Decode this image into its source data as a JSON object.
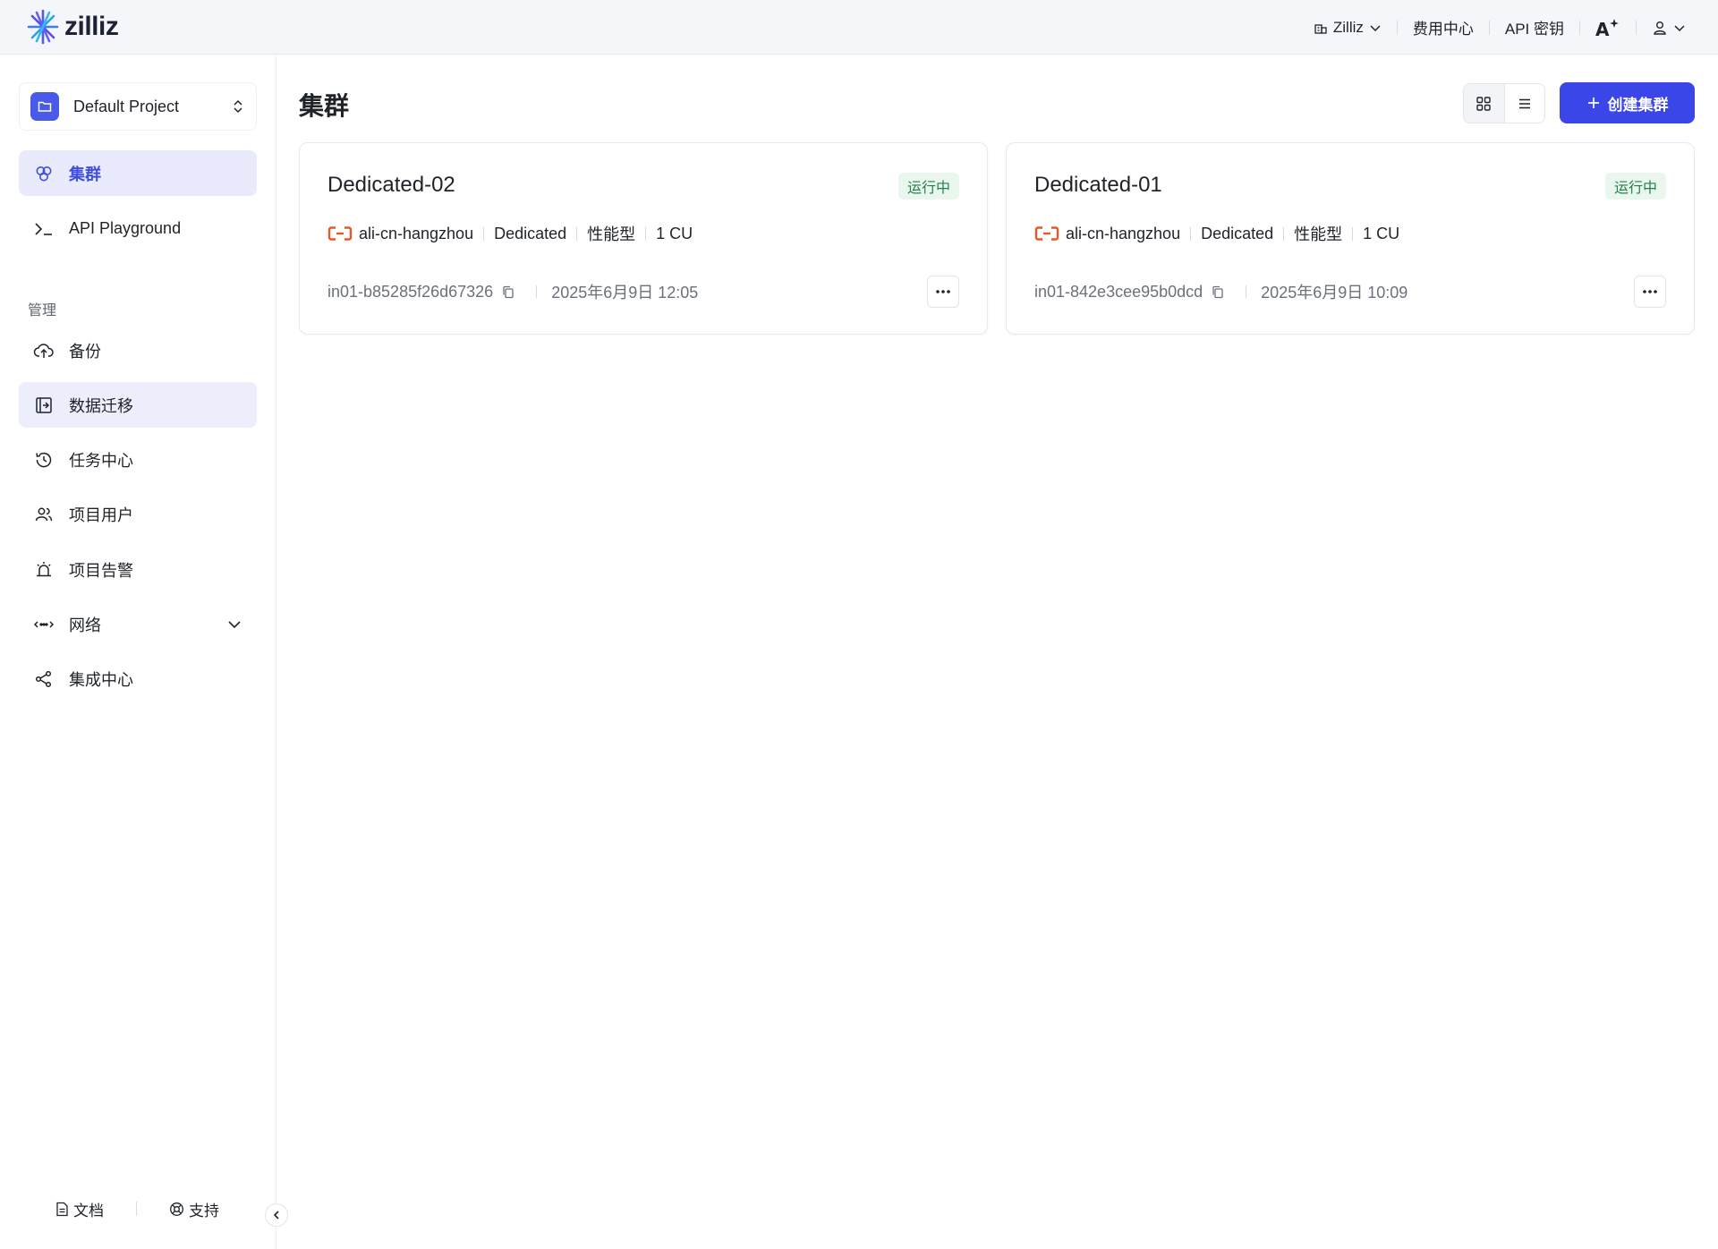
{
  "app": {
    "logo_text": "zilliz"
  },
  "topnav": {
    "org": "Zilliz",
    "billing": "费用中心",
    "api_keys": "API 密钥"
  },
  "sidebar": {
    "project": "Default Project",
    "items": [
      {
        "label": "集群",
        "icon": "clusters-icon"
      },
      {
        "label": "API Playground",
        "icon": "terminal-icon"
      }
    ],
    "group_title": "管理",
    "manage_items": [
      {
        "label": "备份",
        "icon": "cloud-upload-icon"
      },
      {
        "label": "数据迁移",
        "icon": "migration-icon"
      },
      {
        "label": "任务中心",
        "icon": "history-icon"
      },
      {
        "label": "项目用户",
        "icon": "users-icon"
      },
      {
        "label": "项目告警",
        "icon": "alarm-icon"
      },
      {
        "label": "网络",
        "icon": "network-icon"
      },
      {
        "label": "集成中心",
        "icon": "share-icon"
      }
    ],
    "footer": {
      "docs": "文档",
      "support": "支持"
    }
  },
  "main": {
    "title": "集群",
    "create_label": "创建集群",
    "clusters": [
      {
        "name": "Dedicated-02",
        "status": "运行中",
        "region": "ali-cn-hangzhou",
        "plan": "Dedicated",
        "type": "性能型",
        "cu": "1 CU",
        "id": "in01-b85285f26d67326",
        "created": "2025年6月9日 12:05"
      },
      {
        "name": "Dedicated-01",
        "status": "运行中",
        "region": "ali-cn-hangzhou",
        "plan": "Dedicated",
        "type": "性能型",
        "cu": "1 CU",
        "id": "in01-842e3cee95b0dcd",
        "created": "2025年6月9日 10:09"
      }
    ]
  },
  "colors": {
    "accent": "#3b46e8",
    "status_bg": "#eaf7ee",
    "status_text": "#22804a",
    "cloud": "#e8562a"
  }
}
